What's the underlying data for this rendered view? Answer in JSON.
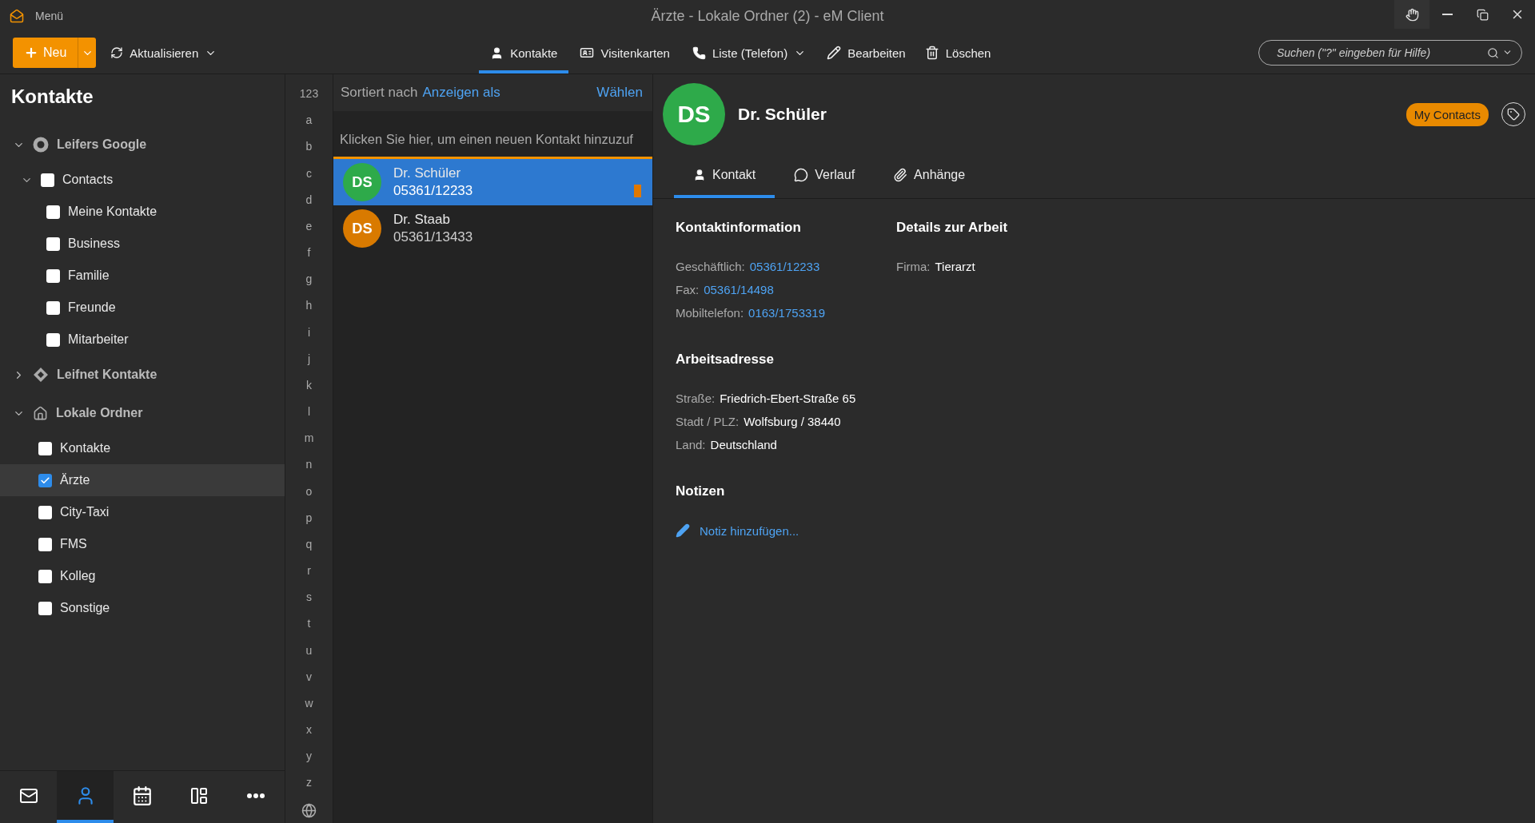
{
  "window": {
    "menu": "Menü",
    "title": "Ärzte - Lokale Ordner (2) - eM Client"
  },
  "toolbar": {
    "new_button": "Neu",
    "refresh_button": "Aktualisieren",
    "views": [
      {
        "label": "Kontakte",
        "selected": true,
        "dropdown": false
      },
      {
        "label": "Visitenkarten",
        "selected": false,
        "dropdown": false
      },
      {
        "label": "Liste (Telefon)",
        "selected": false,
        "dropdown": true
      }
    ],
    "actions": [
      "Bearbeiten",
      "Löschen"
    ],
    "search": {
      "placeholder": "Suchen (\"?\" eingeben für Hilfe)"
    }
  },
  "sidebar": {
    "title": "Kontakte",
    "tree": [
      {
        "label": "Leifers Google",
        "kind": "account",
        "expanded": true,
        "children": [
          {
            "label": "Contacts",
            "kind": "folder",
            "checked": false,
            "selected": false,
            "expanded": true,
            "children": [
              {
                "label": "Meine Kontakte",
                "kind": "folder",
                "checked": false,
                "selected": false
              },
              {
                "label": "Business",
                "kind": "folder",
                "checked": false,
                "selected": false
              },
              {
                "label": "Familie",
                "kind": "folder",
                "checked": false,
                "selected": false
              },
              {
                "label": "Freunde",
                "kind": "folder",
                "checked": false,
                "selected": false
              },
              {
                "label": "Mitarbeiter",
                "kind": "folder",
                "checked": false,
                "selected": false
              }
            ]
          }
        ]
      },
      {
        "label": "Leifnet Kontakte",
        "kind": "account",
        "expanded": false
      },
      {
        "label": "Lokale Ordner",
        "kind": "account",
        "expanded": true,
        "children": [
          {
            "label": "Kontakte",
            "kind": "folder",
            "checked": false,
            "selected": false
          },
          {
            "label": "Ärzte",
            "kind": "folder",
            "checked": true,
            "selected": true
          },
          {
            "label": "City-Taxi",
            "kind": "folder",
            "checked": false,
            "selected": false
          },
          {
            "label": "FMS",
            "kind": "folder",
            "checked": false,
            "selected": false
          },
          {
            "label": "Kolleg",
            "kind": "folder",
            "checked": false,
            "selected": false
          },
          {
            "label": "Sonstige",
            "kind": "folder",
            "checked": false,
            "selected": false
          }
        ]
      }
    ],
    "nav": [
      {
        "selected": false
      },
      {
        "selected": true
      },
      {
        "selected": false
      },
      {
        "selected": false
      },
      {
        "selected": false
      }
    ]
  },
  "alphabet": [
    "123",
    "a",
    "b",
    "c",
    "d",
    "e",
    "f",
    "g",
    "h",
    "i",
    "j",
    "k",
    "l",
    "m",
    "n",
    "o",
    "p",
    "q",
    "r",
    "s",
    "t",
    "u",
    "v",
    "w",
    "x",
    "y",
    "z"
  ],
  "contact_list": {
    "sort_label": "Sortiert nach",
    "sort_link": "Anzeigen als",
    "select_link": "Wählen",
    "new_contact_placeholder": "Klicken Sie hier, um einen neuen Kontakt hinzuzuf",
    "contacts": [
      {
        "initials": "DS",
        "name": "Dr. Schüler",
        "phone": "05361/12233",
        "color": "#2eaa4a",
        "selected": true,
        "flag": true
      },
      {
        "initials": "DS",
        "name": "Dr. Staab",
        "phone": "05361/13433",
        "color": "#d97a00",
        "selected": false,
        "flag": false
      }
    ]
  },
  "detail": {
    "initials": "DS",
    "name": "Dr. Schüler",
    "category": "My Contacts",
    "tabs": [
      {
        "label": "Kontakt",
        "selected": true
      },
      {
        "label": "Verlauf",
        "selected": false
      },
      {
        "label": "Anhänge",
        "selected": false
      }
    ],
    "sections": [
      {
        "title": "Kontaktinformation",
        "fields": [
          {
            "label": "Geschäftlich:",
            "value": "05361/12233",
            "kind": "link"
          },
          {
            "label": "Fax:",
            "value": "05361/14498",
            "kind": "link"
          },
          {
            "label": "Mobiltelefon:",
            "value": "0163/1753319",
            "kind": "link"
          }
        ]
      },
      {
        "title": "Details zur Arbeit",
        "fields": [
          {
            "label": "Firma:",
            "value": "Tierarzt",
            "kind": "text"
          }
        ]
      },
      {
        "title": "Arbeitsadresse",
        "fields": [
          {
            "label": "Straße:",
            "value": "Friedrich-Ebert-Straße 65",
            "kind": "text"
          },
          {
            "label": "Stadt / PLZ:",
            "value": "Wolfsburg / 38440",
            "kind": "text"
          },
          {
            "label": "Land:",
            "value": "Deutschland",
            "kind": "text"
          }
        ]
      }
    ],
    "notes": {
      "title": "Notizen",
      "add_link": "Notiz hinzufügen..."
    }
  }
}
